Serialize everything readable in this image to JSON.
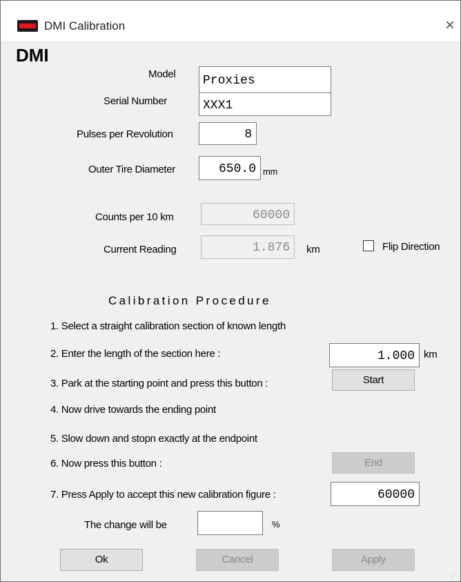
{
  "window": {
    "title": "DMI Calibration",
    "icon": "dmi-app-icon",
    "close_symbol": "×"
  },
  "heading": "DMI",
  "form": {
    "model_label": "Model",
    "model_value": "Proxies",
    "serial_label": "Serial Number",
    "serial_value": "XXX1",
    "pulses_label": "Pulses per Revolution",
    "pulses_value": "8",
    "tire_label": "Outer Tire Diameter",
    "tire_value": "650.0",
    "tire_unit": "mm",
    "counts_label": "Counts per 10 km",
    "counts_value": "60000",
    "reading_label": "Current Reading",
    "reading_value": "1.876",
    "reading_unit": "km",
    "flip_label": "Flip Direction",
    "flip_checked": false
  },
  "procedure": {
    "title": "Calibration Procedure",
    "step1": "1. Select a straight calibration section of known length",
    "step2": "2. Enter the length of the section here :",
    "step2_value": "1.000",
    "step2_unit": "km",
    "step3": "3. Park at the starting point and press this button :",
    "start_label": "Start",
    "step4": "4. Now drive towards the ending point",
    "step5": "5. Slow down and stopn exactly at the endpoint",
    "step6": "6. Now press this button :",
    "end_label": "End",
    "step7": "7. Press Apply to accept this new calibration figure :",
    "step7_value": "60000",
    "change_label": "The change will be",
    "change_value": "",
    "change_unit": "%"
  },
  "buttons": {
    "ok": "Ok",
    "cancel": "Cancel",
    "apply": "Apply"
  }
}
